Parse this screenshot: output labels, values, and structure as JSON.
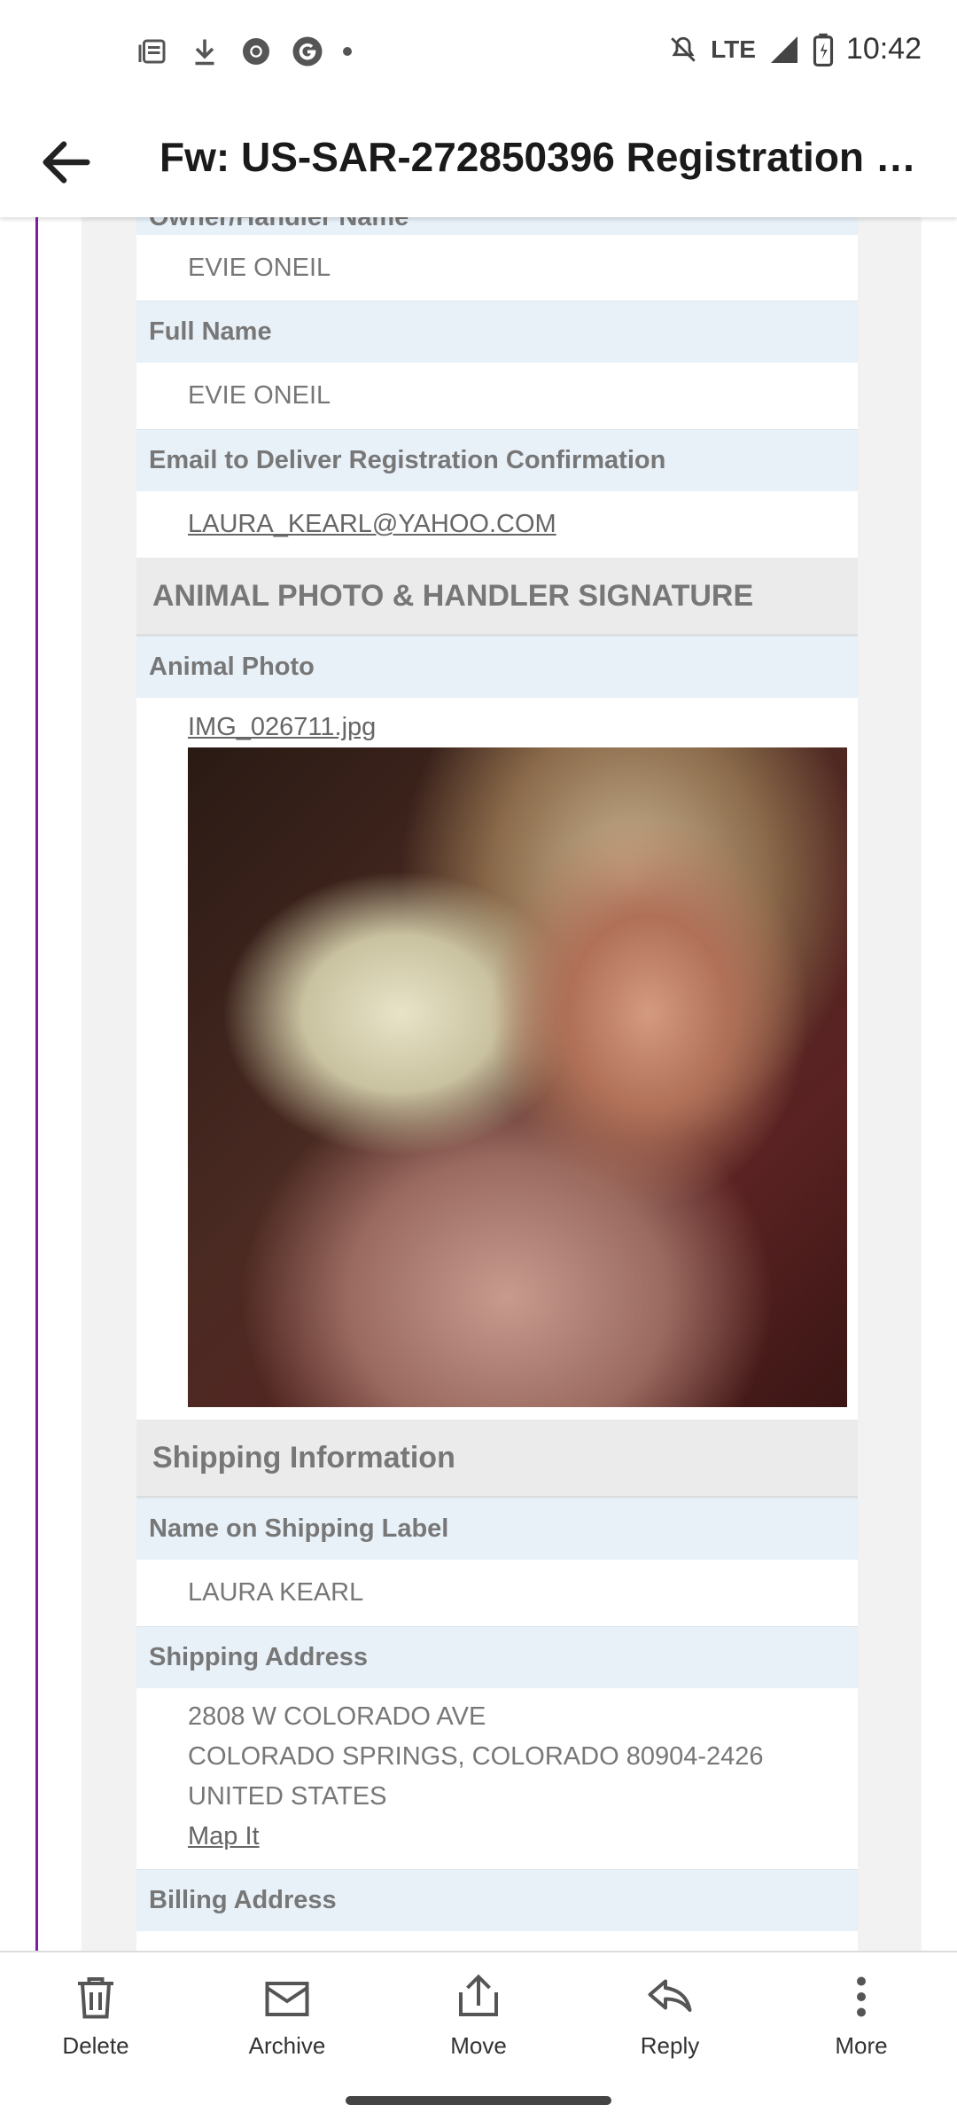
{
  "status_bar": {
    "time": "10:42",
    "network": "LTE",
    "icons": [
      "news-icon",
      "download-icon",
      "chrome-icon",
      "google-icon",
      "dot-icon",
      "mute-icon",
      "signal-icon",
      "battery-icon"
    ]
  },
  "header": {
    "title": "Fw: US-SAR-272850396 Registration Re..."
  },
  "form": {
    "owner_handler_label": "Owner/Handler Name",
    "owner_handler_value": "EVIE ONEIL",
    "full_name_label": "Full Name",
    "full_name_value": "EVIE ONEIL",
    "email_label": "Email to Deliver Registration Confirmation",
    "email_value": "LAURA_KEARL@YAHOO.COM",
    "photo_section_title": "ANIMAL PHOTO & HANDLER SIGNATURE",
    "animal_photo_label": "Animal Photo",
    "animal_photo_file": "IMG_026711.jpg",
    "shipping_section_title": "Shipping Information",
    "shipping_name_label": "Name on Shipping Label",
    "shipping_name_value": "LAURA KEARL",
    "shipping_address_label": "Shipping Address",
    "shipping_address_lines": [
      "2808 W COLORADO AVE",
      "COLORADO SPRINGS, COLORADO 80904-2426",
      "UNITED STATES"
    ],
    "map_link": "Map It",
    "billing_address_label": "Billing Address"
  },
  "toolbar": {
    "delete": "Delete",
    "archive": "Archive",
    "move": "Move",
    "reply": "Reply",
    "more": "More"
  },
  "colors": {
    "thread_line": "#7b1fa2",
    "label_bg": "#e8f0f8",
    "section_bg": "#ebebeb"
  }
}
